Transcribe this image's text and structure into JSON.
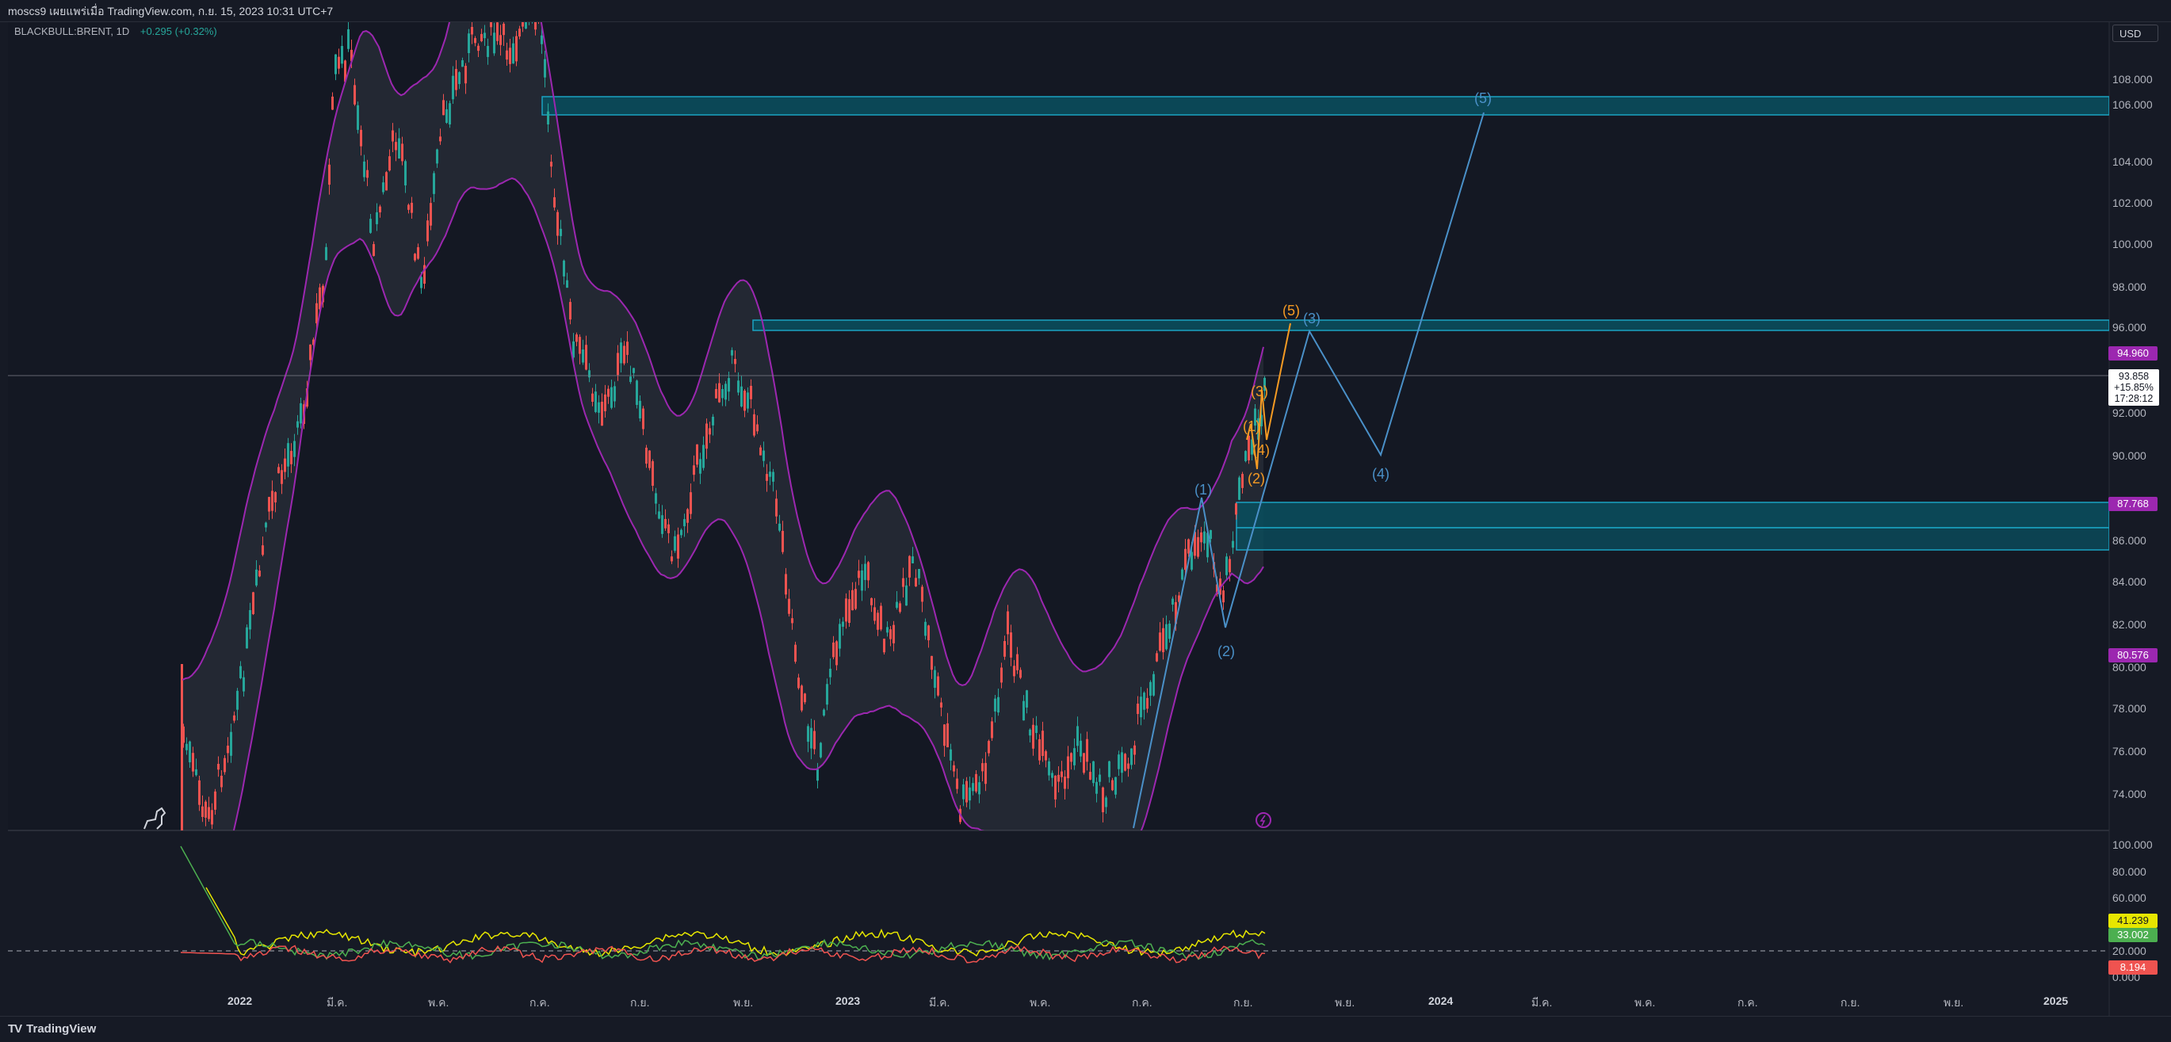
{
  "header": {
    "title": "moscs9 เผยแพร่เมื่อ TradingView.com, ก.ย. 15, 2023 10:31 UTC+7"
  },
  "symbol": {
    "name": "BLACKBULL:BRENT, 1D",
    "change": "+0.295 (+0.32%)"
  },
  "currency": "USD",
  "price_axis": [
    "108.000",
    "106.000",
    "104.000",
    "102.000",
    "100.000",
    "98.000",
    "96.000",
    "92.000",
    "90.000",
    "86.000",
    "84.000",
    "82.000",
    "80.000",
    "78.000",
    "76.000",
    "74.000"
  ],
  "price_tags": {
    "upper_band": "94.960",
    "zone": "87.768",
    "lower_band": "80.576"
  },
  "last_price": {
    "price": "93.858",
    "change_pct": "+15.85%",
    "countdown": "17:28:12"
  },
  "indicator_axis": [
    "100.000",
    "80.000",
    "60.000",
    "40.000",
    "20.000",
    "0.000"
  ],
  "indicator_tags": {
    "yellow": "41.239",
    "green": "33.002",
    "red": "8.194"
  },
  "time_axis": [
    {
      "label": "2022",
      "bold": true
    },
    {
      "label": "มี.ค.",
      "bold": false
    },
    {
      "label": "พ.ค.",
      "bold": false
    },
    {
      "label": "ก.ค.",
      "bold": false
    },
    {
      "label": "ก.ย.",
      "bold": false
    },
    {
      "label": "พ.ย.",
      "bold": false
    },
    {
      "label": "2023",
      "bold": true
    },
    {
      "label": "มี.ค.",
      "bold": false
    },
    {
      "label": "พ.ค.",
      "bold": false
    },
    {
      "label": "ก.ค.",
      "bold": false
    },
    {
      "label": "ก.ย.",
      "bold": false
    },
    {
      "label": "พ.ย.",
      "bold": false
    },
    {
      "label": "2024",
      "bold": true
    },
    {
      "label": "มี.ค.",
      "bold": false
    },
    {
      "label": "พ.ค.",
      "bold": false
    },
    {
      "label": "ก.ค.",
      "bold": false
    },
    {
      "label": "ก.ย.",
      "bold": false
    },
    {
      "label": "พ.ย.",
      "bold": false
    },
    {
      "label": "2025",
      "bold": true
    }
  ],
  "wave_labels": {
    "blue": [
      "(1)",
      "(2)",
      "(3)",
      "(4)",
      "(5)"
    ],
    "orange": [
      "(1)",
      "(2)",
      "(3)",
      "(4)",
      "(5)"
    ]
  },
  "colors": {
    "background": "#161a25",
    "band": "#9c27b0",
    "zone": "#0a4d5c",
    "up_candle": "#26a69a",
    "down_candle": "#ef5350",
    "wave_blue": "#4a90c8",
    "wave_orange": "#f59a23"
  },
  "footer": {
    "brand": "TradingView",
    "logo": "TV"
  }
}
